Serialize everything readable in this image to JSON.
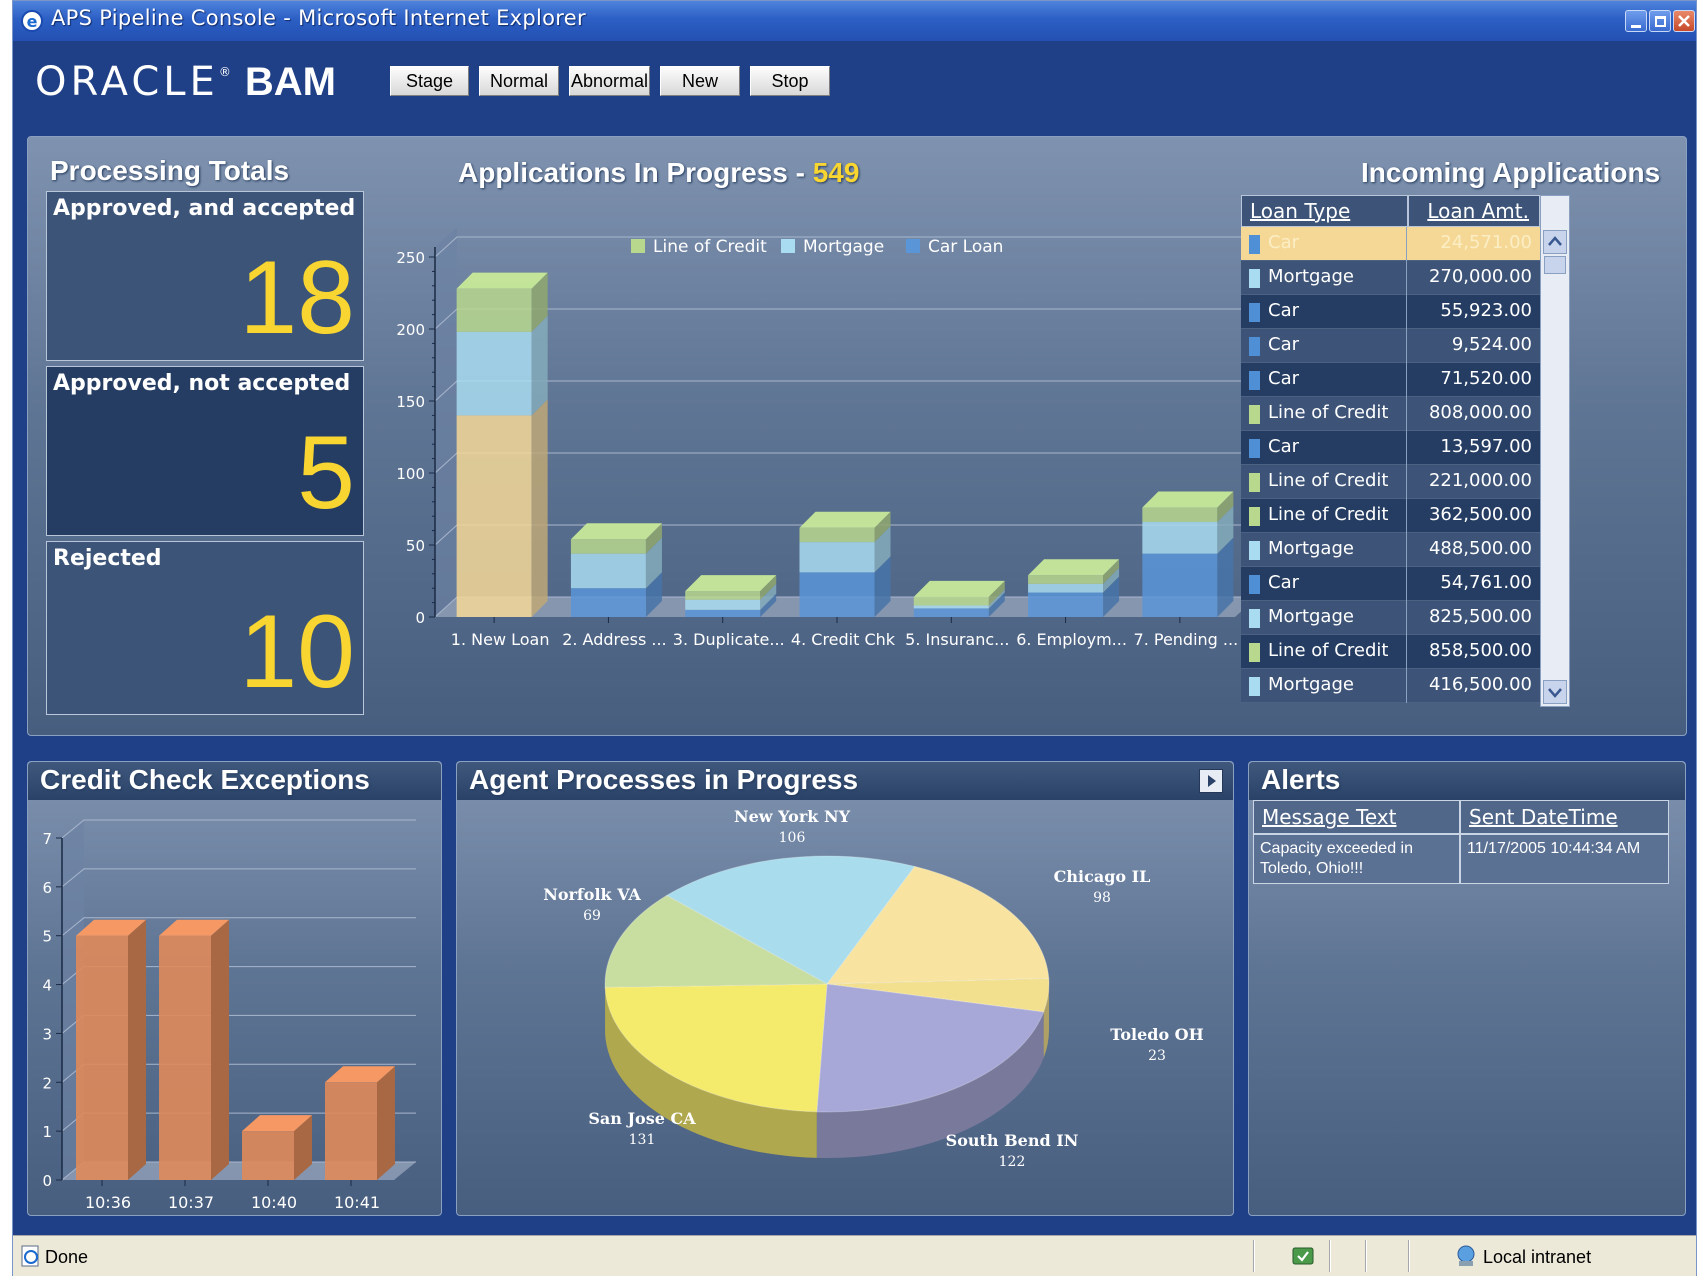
{
  "window": {
    "title": "APS Pipeline Console - Microsoft Internet Explorer"
  },
  "header": {
    "logo_oracle": "ORACLE",
    "logo_registered": "®",
    "logo_bam": "BAM",
    "buttons": [
      "Stage",
      "Normal",
      "Abnormal",
      "New",
      "Stop"
    ]
  },
  "processing_totals": {
    "title": "Processing Totals",
    "items": [
      {
        "label": "Approved, and accepted",
        "value": "18"
      },
      {
        "label": "Approved, not accepted",
        "value": "5"
      },
      {
        "label": "Rejected",
        "value": "10"
      }
    ]
  },
  "applications": {
    "title": "Applications In Progress -",
    "total": "549",
    "legend": [
      "Line of Credit",
      "Mortgage",
      "Car Loan"
    ]
  },
  "incoming": {
    "title": "Incoming Applications",
    "col_type": "Loan Type",
    "col_amount": "Loan Amt.",
    "rows": [
      {
        "type": "Car",
        "amount": "24,571.00",
        "color": "#4f8fd6"
      },
      {
        "type": "Mortgage",
        "amount": "270,000.00",
        "color": "#a9dcf0"
      },
      {
        "type": "Car",
        "amount": "55,923.00",
        "color": "#4f8fd6"
      },
      {
        "type": "Car",
        "amount": "9,524.00",
        "color": "#4f8fd6"
      },
      {
        "type": "Car",
        "amount": "71,520.00",
        "color": "#4f8fd6"
      },
      {
        "type": "Line of Credit",
        "amount": "808,000.00",
        "color": "#b8d88e"
      },
      {
        "type": "Car",
        "amount": "13,597.00",
        "color": "#4f8fd6"
      },
      {
        "type": "Line of Credit",
        "amount": "221,000.00",
        "color": "#b8d88e"
      },
      {
        "type": "Line of Credit",
        "amount": "362,500.00",
        "color": "#b8d88e"
      },
      {
        "type": "Mortgage",
        "amount": "488,500.00",
        "color": "#a9dcf0"
      },
      {
        "type": "Car",
        "amount": "54,761.00",
        "color": "#4f8fd6"
      },
      {
        "type": "Mortgage",
        "amount": "825,500.00",
        "color": "#a9dcf0"
      },
      {
        "type": "Line of Credit",
        "amount": "858,500.00",
        "color": "#b8d88e"
      },
      {
        "type": "Mortgage",
        "amount": "416,500.00",
        "color": "#a9dcf0"
      }
    ]
  },
  "credit_check": {
    "title": "Credit Check Exceptions"
  },
  "agent": {
    "title": "Agent Processes in Progress"
  },
  "alerts": {
    "title": "Alerts",
    "col_message": "Message Text",
    "col_sent": "Sent DateTime",
    "rows": [
      {
        "message": "Capacity exceeded in Toledo, Ohio!!!",
        "sent": "11/17/2005 10:44:34 AM"
      }
    ]
  },
  "statusbar": {
    "status": "Done",
    "zone": "Local intranet"
  },
  "chart_data": [
    {
      "type": "bar",
      "stacked": true,
      "title": "Applications In Progress - 549",
      "categories": [
        "1. New Loan",
        "2. Address ...",
        "3. Duplicate...",
        "4. Credit Chk",
        "5. Insuranc...",
        "6. Employm...",
        "7. Pending ..."
      ],
      "series": [
        {
          "name": "Car Loan",
          "values": [
            140,
            20,
            5,
            31,
            6,
            17,
            44
          ],
          "color": "#5a95d8"
        },
        {
          "name": "Mortgage",
          "values": [
            58,
            24,
            7,
            21,
            2,
            6,
            22
          ],
          "color": "#a9dcf0"
        },
        {
          "name": "Line of Credit",
          "values": [
            30,
            10,
            6,
            10,
            6,
            6,
            10
          ],
          "color": "#b8d88e"
        }
      ],
      "ylim": [
        0,
        250
      ],
      "yticks": [
        0,
        50,
        100,
        150,
        200,
        250
      ],
      "legend": "top",
      "grid": true
    },
    {
      "type": "bar",
      "title": "Credit Check Exceptions",
      "categories": [
        "10:36",
        "10:37",
        "10:40",
        "10:41"
      ],
      "values": [
        5,
        5,
        1,
        2
      ],
      "ylim": [
        0,
        7
      ],
      "yticks": [
        0,
        1,
        2,
        3,
        4,
        5,
        6,
        7
      ],
      "color": "#e08a5a",
      "grid": true
    },
    {
      "type": "pie",
      "title": "Agent Processes in Progress",
      "labels": [
        "New York NY",
        "Chicago IL",
        "Toledo OH",
        "South Bend IN",
        "San Jose CA",
        "Norfolk VA"
      ],
      "values": [
        106,
        98,
        23,
        122,
        131,
        69
      ],
      "colors": [
        "#a9dcec",
        "#f8e4a0",
        "#f3e08e",
        "#a8a8d8",
        "#f4ea6c",
        "#c8dda0"
      ]
    }
  ]
}
